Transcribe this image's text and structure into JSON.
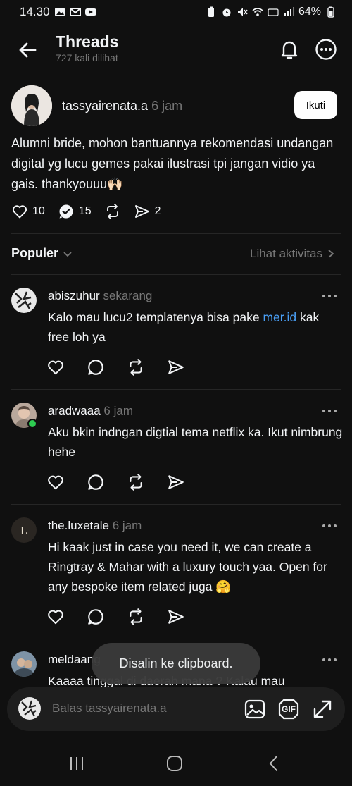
{
  "status_bar": {
    "time": "14.30",
    "battery": "64%"
  },
  "header": {
    "title": "Threads",
    "subtitle": "727 kali dilihat"
  },
  "op": {
    "username": "tassyairenata.a",
    "time": "6 jam",
    "follow_label": "Ikuti",
    "text": "Alumni bride, mohon bantuannya rekomendasi undangan digital yg lucu gemes pakai ilustrasi tpi jangan vidio ya gais. thankyouuu🙌🏻",
    "likes": "10",
    "replies": "15",
    "shares": "2"
  },
  "sort": {
    "label": "Populer",
    "activity_label": "Lihat aktivitas"
  },
  "replies": [
    {
      "username": "abiszuhur",
      "time": "sekarang",
      "text_before": "Kalo mau lucu2 templatenya bisa pake ",
      "link": "mer.id",
      "text_after": " kak free loh ya"
    },
    {
      "username": "aradwaaa",
      "time": "6 jam",
      "text": "Aku bkin indngan digtial tema netflix ka. Ikut nimbrung hehe"
    },
    {
      "username": "the.luxetale",
      "time": "6 jam",
      "text": "Hi kaak just in case you need it, we can create a Ringtray & Mahar with a luxury touch yaa. Open for any bespoke item related juga 🤗"
    },
    {
      "username": "meldaang",
      "time": "",
      "text": "Kaaaa tinggal di daerah mana ? Kalau mau"
    }
  ],
  "toast": "Disalin ke clipboard.",
  "reply_bar": {
    "placeholder": "Balas tassyairenata.a",
    "gif_label": "GIF"
  },
  "colors": {
    "background": "#101010",
    "link": "#4a9ff5",
    "online": "#2ecc51",
    "secondary_text": "#777777"
  }
}
